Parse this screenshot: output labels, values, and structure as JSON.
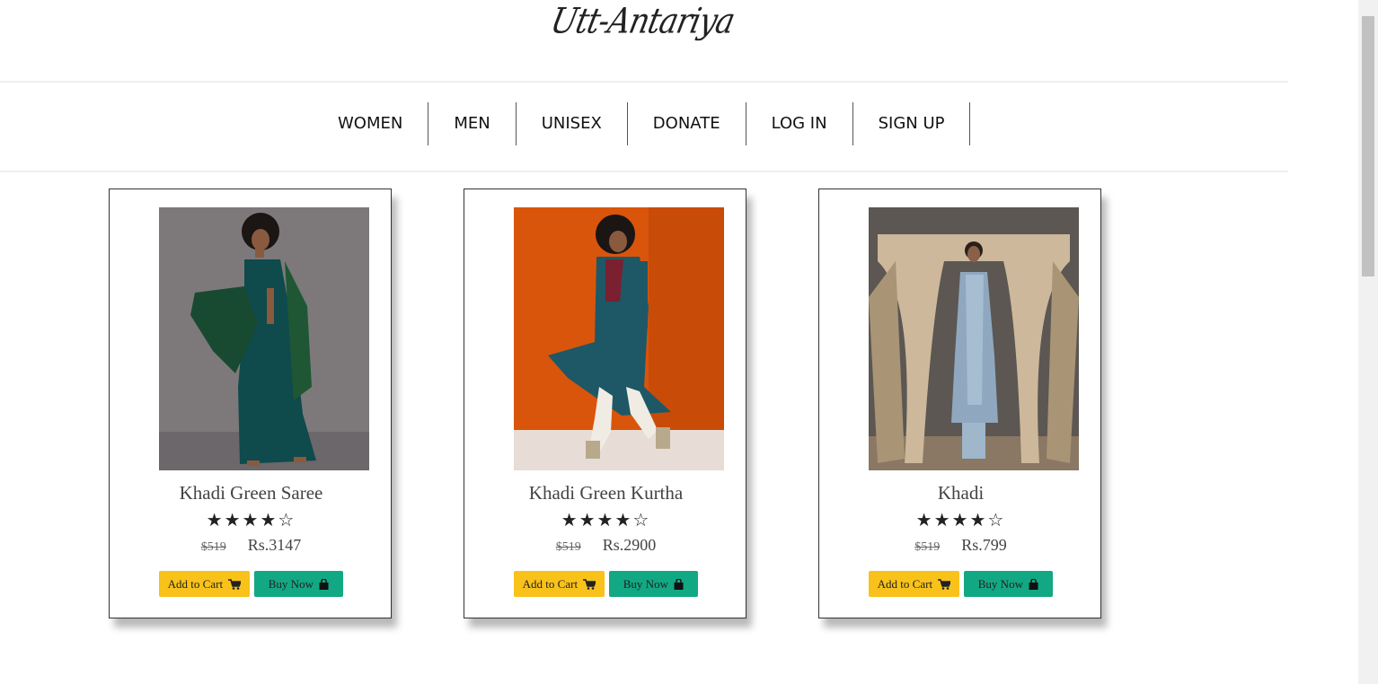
{
  "brand": {
    "logo_text": "Utt-Antariya"
  },
  "nav": {
    "items": [
      "WOMEN",
      "MEN",
      "UNISEX",
      "DONATE",
      "LOG IN",
      "SIGN UP"
    ]
  },
  "products": [
    {
      "title": "Khadi Green Saree",
      "rating": 4,
      "rating_max": 5,
      "old_price": "$519",
      "price": "Rs.3147",
      "add_label": "Add to Cart",
      "buy_label": "Buy Now"
    },
    {
      "title": "Khadi Green Kurtha",
      "rating": 4,
      "rating_max": 5,
      "old_price": "$519",
      "price": "Rs.2900",
      "add_label": "Add to Cart",
      "buy_label": "Buy Now"
    },
    {
      "title": "Khadi",
      "rating": 4,
      "rating_max": 5,
      "old_price": "$519",
      "price": "Rs.799",
      "add_label": "Add to Cart",
      "buy_label": "Buy Now"
    }
  ],
  "colors": {
    "add_to_cart": "#f8c21a",
    "buy_now": "#12a883"
  }
}
